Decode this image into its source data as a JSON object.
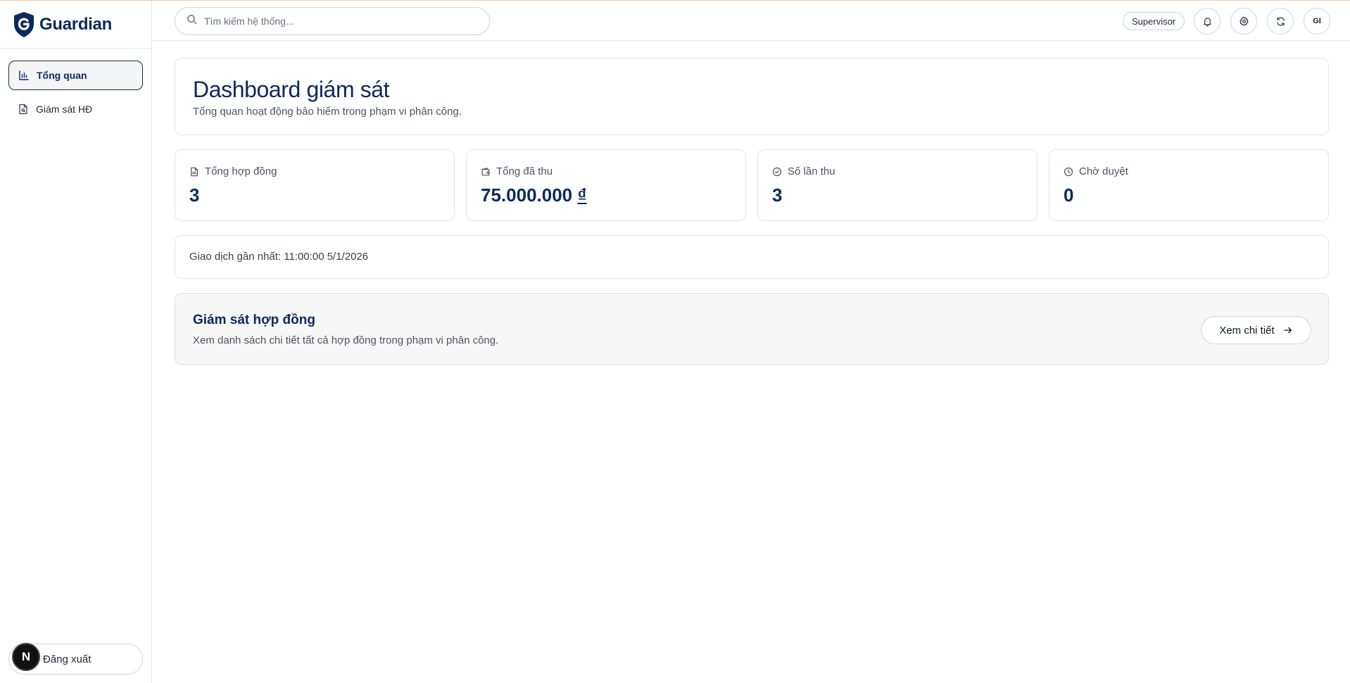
{
  "brand": {
    "name": "Guardian"
  },
  "sidebar": {
    "items": [
      {
        "label": "Tổng quan",
        "icon": "bar-chart-icon",
        "active": true
      },
      {
        "label": "Giám sát HĐ",
        "icon": "file-search-icon",
        "active": false
      }
    ],
    "logout_label": "Đăng xuất",
    "badge_letter": "N"
  },
  "header": {
    "search_placeholder": "Tìm kiếm hệ thống...",
    "role": "Supervisor",
    "avatar_initials": "GI",
    "icons": [
      "bell-icon",
      "gear-icon",
      "refresh-icon"
    ]
  },
  "page": {
    "title": "Dashboard giám sát",
    "subtitle": "Tổng quan hoạt động bảo hiểm trong phạm vi phân công."
  },
  "stats": [
    {
      "label": "Tổng hợp đồng",
      "value": "3",
      "icon": "document-icon"
    },
    {
      "label": "Tổng đã thu",
      "value": "75.000.000",
      "currency": "₫",
      "icon": "wallet-icon"
    },
    {
      "label": "Số lần thu",
      "value": "3",
      "icon": "check-circle-icon"
    },
    {
      "label": "Chờ duyệt",
      "value": "0",
      "icon": "clock-icon"
    }
  ],
  "latest_transaction": "Giao dịch gần nhất: 11:00:00 5/1/2026",
  "monitor": {
    "title": "Giám sát hợp đồng",
    "subtitle": "Xem danh sách chi tiết tất cả hợp đồng trong phạm vi phân công.",
    "button_label": "Xem chi tiết"
  },
  "colors": {
    "brand_navy": "#0b2a5b",
    "border": "#e3e5e9",
    "muted_text": "#4b5563"
  }
}
